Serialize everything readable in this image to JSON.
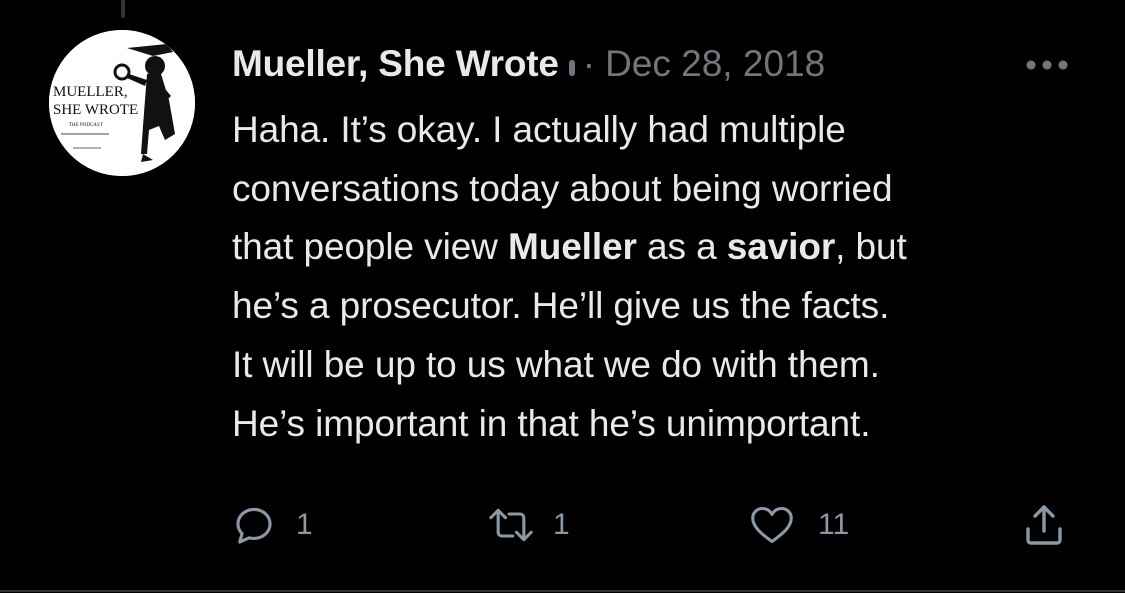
{
  "tweet": {
    "author": {
      "display_name": "Mueller, She Wrote",
      "avatar_text": {
        "line1": "MUELLER,",
        "line2": "SHE WROTE",
        "line3": "THE PODCAST"
      }
    },
    "separator": "·",
    "timestamp": "Dec 28, 2018",
    "more_icon": "more-horizontal-icon",
    "text": {
      "line1": "Haha. It’s okay. I actually had multiple",
      "line2": "conversations today about being worried",
      "line3_a": "that people view ",
      "line3_b": "Mueller",
      "line3_c": " as a ",
      "line3_d": "savior",
      "line3_e": ", but",
      "line4": "he’s a prosecutor. He’ll give us the facts.",
      "line5": "It will be up to us what we do with them.",
      "line6": "He’s important in that he’s unimportant."
    },
    "actions": {
      "reply": {
        "icon": "reply-icon",
        "count": "1"
      },
      "retweet": {
        "icon": "retweet-icon",
        "count": "1"
      },
      "like": {
        "icon": "heart-icon",
        "count": "11"
      },
      "share": {
        "icon": "share-icon"
      }
    }
  },
  "colors": {
    "background": "#000000",
    "text": "#e7e9ea",
    "secondary": "#71767b",
    "icon": "#8b98a5"
  }
}
